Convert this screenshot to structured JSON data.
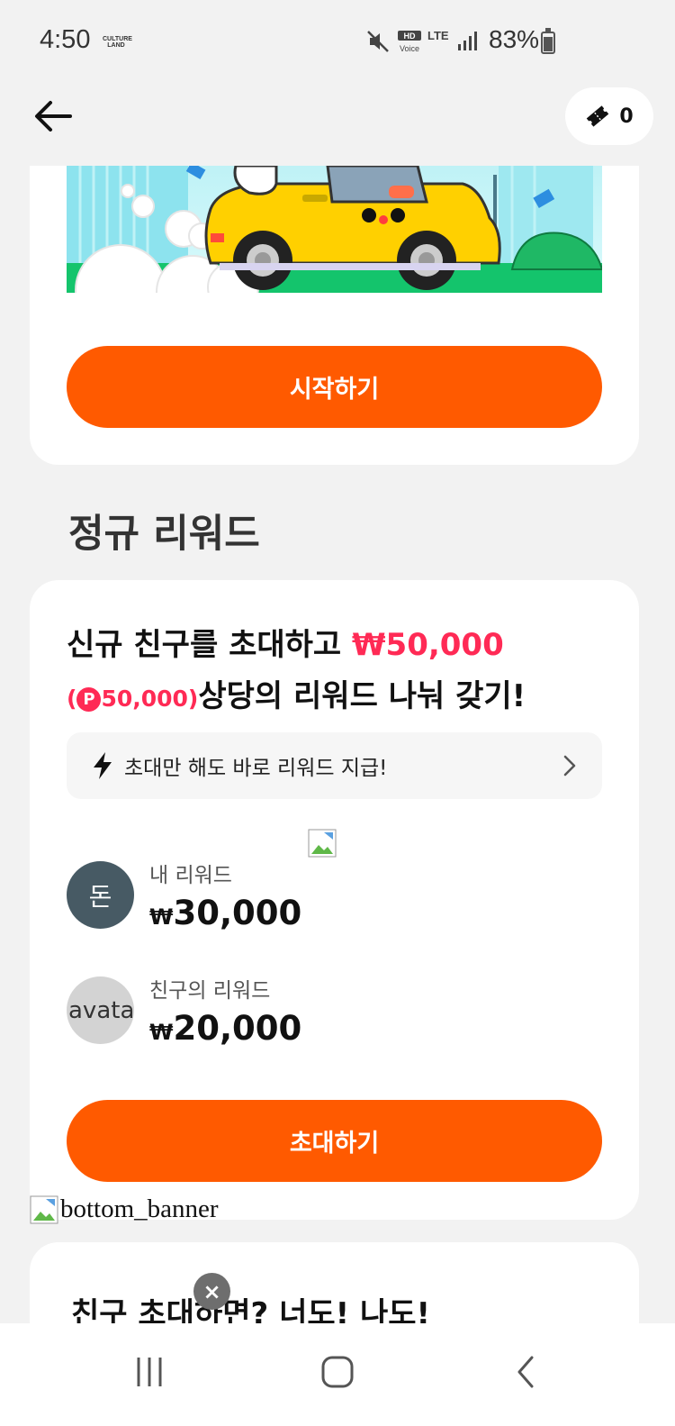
{
  "status_bar": {
    "time": "4:50",
    "app_indicator": "CULTURE LAND",
    "network": "LTE",
    "battery": "83%"
  },
  "header": {
    "ticket_count": "0"
  },
  "event_card": {
    "start_label": "시작하기"
  },
  "section": {
    "title": "정규 리워드"
  },
  "reward_card": {
    "headline_prefix": "신규 친구를 초대하고 ",
    "headline_amount": "₩50,000",
    "point_open": "(",
    "point_icon": "P",
    "point_amount": "50,000)",
    "headline_suffix": "상당의 리워드 나눠 갖기!",
    "info_text": "초대만 해도 바로 리워드 지급!",
    "my_avatar_initial": "돈",
    "my_label": "내 리워드",
    "my_currency": "₩",
    "my_amount": "30,000",
    "friend_avatar_alt": "avatar",
    "friend_label": "친구의 리워드",
    "friend_currency": "₩",
    "friend_amount": "20,000",
    "invite_label": "초대하기"
  },
  "bottom_banner": {
    "alt": "bottom_banner"
  },
  "bottom_card": {
    "title": "친구 초대하면? 너도! 나도!",
    "close_glyph": "×"
  },
  "colors": {
    "accent": "#ff5a00",
    "highlight": "#ff2a55",
    "background": "#f2f2f2"
  },
  "icons": [
    "back-arrow-icon",
    "ticket-icon",
    "lightning-icon",
    "chevron-right-icon",
    "broken-image-icon",
    "nav-recents-icon",
    "nav-home-icon",
    "nav-back-icon"
  ]
}
